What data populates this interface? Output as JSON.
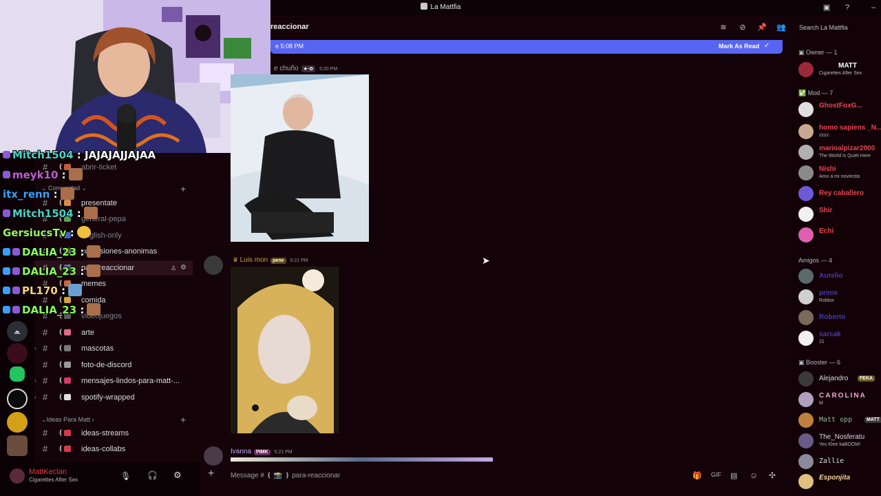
{
  "window": {
    "title": "La Mattfia"
  },
  "channel": {
    "name": "reaccionar",
    "new_since": "e 5:08 PM",
    "mark_read": "Mark As Read"
  },
  "search": {
    "placeholder": "Search La Mattfia"
  },
  "overlay_chat": [
    {
      "user": "Mitch1504",
      "text": " : JAJAJAJJAJAA",
      "color": "#4ad2c8"
    },
    {
      "user": "meyk10",
      "text": " :",
      "color": "#c85ad6"
    },
    {
      "user": "itx_renn",
      "text": " :",
      "color": "#3aa0ff"
    },
    {
      "user": "Mitch1504",
      "text": " :",
      "color": "#4ad2c8"
    },
    {
      "user": "GersiucsTv",
      "text": " :",
      "color": "#a0f060"
    },
    {
      "user": "DALIA_23",
      "text": " :",
      "color": "#8bff5a"
    },
    {
      "user": "DALIA_23",
      "text": " :",
      "color": "#8bff5a"
    },
    {
      "user": "PL170",
      "text": " :",
      "color": "#ffd27a"
    },
    {
      "user": "DALIA_23",
      "text": " :",
      "color": "#8bff5a"
    }
  ],
  "sidebar": {
    "rows": [
      {
        "name": "abrir-ticket",
        "dim": true
      },
      {
        "name": "presentate",
        "dim": false
      },
      {
        "name": "general-pepa",
        "dim": true
      },
      {
        "name": "english-only",
        "dim": true
      },
      {
        "name": "confesiones-anonimas",
        "dim": false
      },
      {
        "name": "para-reaccionar",
        "dim": false
      },
      {
        "name": "memes",
        "dim": false
      },
      {
        "name": "comida",
        "dim": false
      },
      {
        "name": "videojuegos",
        "dim": true
      },
      {
        "name": "arte",
        "dim": false
      },
      {
        "name": "mascotas",
        "dim": false
      },
      {
        "name": "foto-de-discord",
        "dim": false
      },
      {
        "name": "mensajes-lindos-para-matt-...",
        "dim": false
      },
      {
        "name": "spotify-wrapped",
        "dim": false
      },
      {
        "name": "ideas-streams",
        "dim": false
      },
      {
        "name": "ideas-collabs",
        "dim": false
      }
    ],
    "category_community": "Comunidad",
    "category_ideas": "Ideas Para Matt"
  },
  "user_panel": {
    "name": "MattKeclan",
    "status": "Cigarettes After Sex"
  },
  "messages": [
    {
      "author": "e chuño",
      "time": "5:20 PM",
      "color": "#a8a8a8"
    },
    {
      "author": "Luis mon",
      "tag": "pene",
      "time": "5:21 PM",
      "color": "#c9a14a"
    },
    {
      "author": "Ivanna",
      "tag": "PIMK",
      "time": "5:21 PM",
      "color": "#c8a8ff"
    }
  ],
  "composer": {
    "placeholder": "Message # ❪ 📸 ❫ para-reaccionar"
  },
  "members": {
    "groups": [
      {
        "label": "Owner — 1"
      },
      {
        "label": "Mod — 7"
      },
      {
        "label": "Amigos — 4"
      },
      {
        "label": "Booster — 6"
      }
    ],
    "owner": [
      {
        "name": "MATT",
        "sub": "Cigarettes After Sex",
        "color": "#ffffff"
      }
    ],
    "mods": [
      {
        "name": "GhostFoxG...",
        "sub": "",
        "color": "#e8434f"
      },
      {
        "name": "homo sapiens _N...",
        "sub": "zzzz",
        "color": "#e8434f"
      },
      {
        "name": "marioalpizar2000",
        "sub": "The World is Quiet Here",
        "color": "#e8434f"
      },
      {
        "name": "Nishi",
        "sub": "Amo a mi noviecita",
        "color": "#e8434f"
      },
      {
        "name": "Rey caballero",
        "sub": "",
        "color": "#e8434f"
      },
      {
        "name": "Shir",
        "sub": "",
        "color": "#e8434f"
      },
      {
        "name": "Echi",
        "sub": "",
        "color": "#e8434f"
      }
    ],
    "amigos": [
      {
        "name": "Aurelio",
        "sub": "",
        "color": "#4a3aaa"
      },
      {
        "name": "prime",
        "sub": "Roblox",
        "color": "#4a3aaa"
      },
      {
        "name": "Roberto",
        "sub": "",
        "color": "#4a3aaa"
      },
      {
        "name": "sarcak",
        "sub": "21",
        "color": "#4a3aaa"
      }
    ],
    "boosters": [
      {
        "name": "Alejandro",
        "tag": "FEKA",
        "sub": "",
        "color": "#dbdee1"
      },
      {
        "name": "CAROLINA",
        "sub": "M",
        "color": "#f2a8d8"
      },
      {
        "name": "Matt opp",
        "tag": "MATT",
        "sub": "",
        "color": "#8fb7a0"
      },
      {
        "name": "The_Nosferatu",
        "sub": "Yes Klee kaBOOM!",
        "color": "#dbdee1"
      },
      {
        "name": "Zallie",
        "sub": "",
        "color": "#dbdee1"
      },
      {
        "name": "Esponjita",
        "sub": "",
        "color": "#f2d6a0"
      }
    ]
  }
}
